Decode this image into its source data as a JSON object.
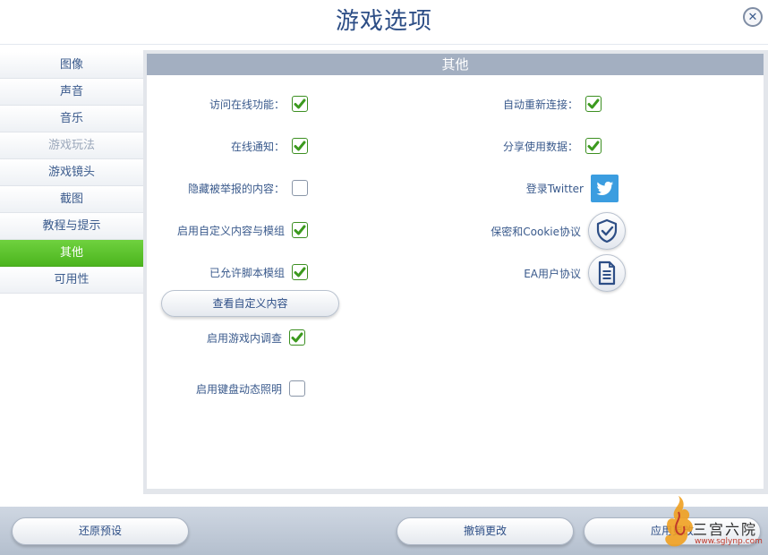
{
  "window": {
    "title": "游戏选项"
  },
  "sidebar": {
    "items": [
      {
        "label": "图像",
        "state": "normal"
      },
      {
        "label": "声音",
        "state": "normal"
      },
      {
        "label": "音乐",
        "state": "normal"
      },
      {
        "label": "游戏玩法",
        "state": "disabled"
      },
      {
        "label": "游戏镜头",
        "state": "normal"
      },
      {
        "label": "截图",
        "state": "normal"
      },
      {
        "label": "教程与提示",
        "state": "normal"
      },
      {
        "label": "其他",
        "state": "active"
      },
      {
        "label": "可用性",
        "state": "normal"
      }
    ]
  },
  "panel": {
    "header": "其他",
    "left_options": [
      {
        "label": "访问在线功能：",
        "checked": true
      },
      {
        "label": "在线通知：",
        "checked": true
      },
      {
        "label": "隐藏被举报的内容：",
        "checked": false
      },
      {
        "label": "启用自定义内容与模组",
        "checked": true
      },
      {
        "label": "已允许脚本模组",
        "checked": true
      }
    ],
    "view_custom_content_label": "查看自定义内容",
    "lower_options": [
      {
        "label": "启用游戏内调查",
        "checked": true
      },
      {
        "label": "启用键盘动态照明",
        "checked": false
      }
    ],
    "right_options": [
      {
        "label": "自动重新连接：",
        "checked": true
      },
      {
        "label": "分享使用数据：",
        "checked": true
      }
    ],
    "links": {
      "twitter": "登录Twitter",
      "privacy": "保密和Cookie协议",
      "eula": "EA用户协议"
    }
  },
  "footer": {
    "restore_defaults": "还原预设",
    "undo_changes": "撤销更改",
    "apply_changes": "应用更改"
  },
  "watermark": {
    "text": "三宫六院",
    "url": "www.sglynp.com"
  },
  "colors": {
    "accent_green": "#4cb41e",
    "title_blue": "#2d4e86",
    "header_gray": "#a3afc1",
    "twitter_blue": "#3b9de0"
  }
}
